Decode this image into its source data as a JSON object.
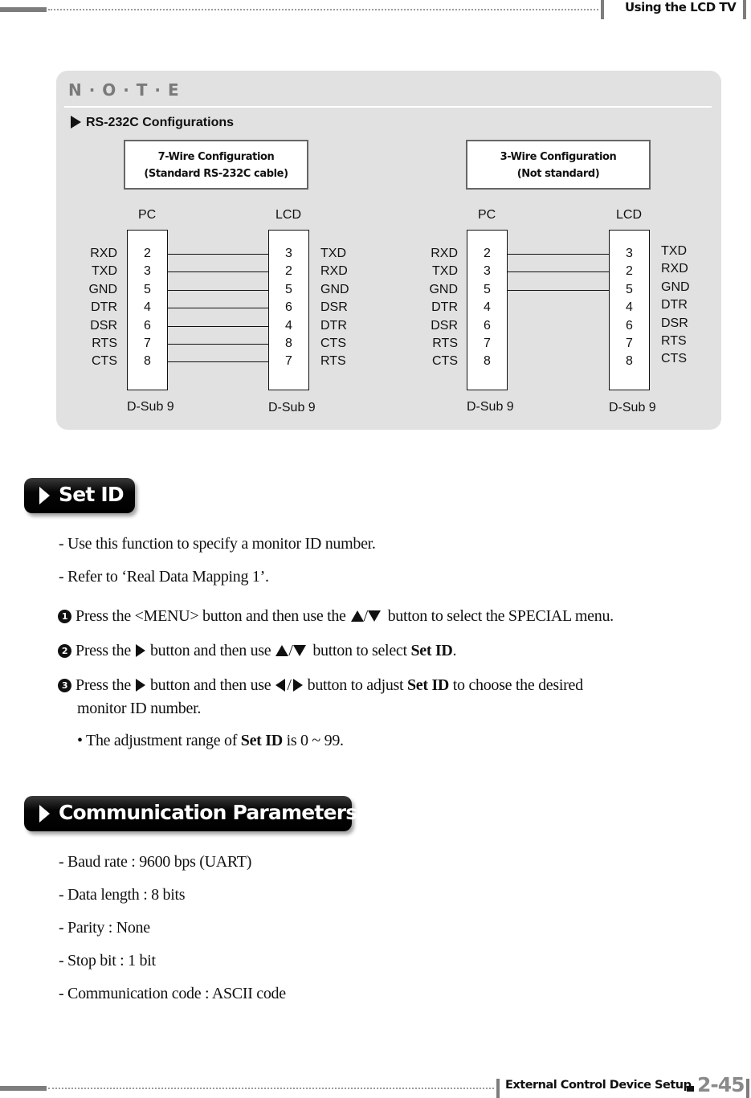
{
  "header": {
    "title": "Using the LCD TV"
  },
  "note": {
    "title": "N · O · T · E",
    "subtitle": "RS-232C Configurations",
    "configs": [
      {
        "title_line1": "7-Wire Configuration",
        "title_line2": "(Standard RS-232C cable)",
        "pc_label": "PC",
        "lcd_label": "LCD",
        "pc_signals": [
          "RXD",
          "TXD",
          "GND",
          "DTR",
          "DSR",
          "RTS",
          "CTS"
        ],
        "pc_pins": [
          "2",
          "3",
          "5",
          "4",
          "6",
          "7",
          "8"
        ],
        "lcd_pins": [
          "3",
          "2",
          "5",
          "6",
          "4",
          "8",
          "7"
        ],
        "lcd_signals": [
          "TXD",
          "RXD",
          "GND",
          "DSR",
          "DTR",
          "CTS",
          "RTS"
        ],
        "wired_rows": [
          0,
          1,
          2,
          3,
          4,
          5,
          6
        ],
        "pc_connector": "D-Sub 9",
        "lcd_connector": "D-Sub 9"
      },
      {
        "title_line1": "3-Wire Configuration",
        "title_line2": "(Not standard)",
        "pc_label": "PC",
        "lcd_label": "LCD",
        "pc_signals": [
          "RXD",
          "TXD",
          "GND",
          "DTR",
          "DSR",
          "RTS",
          "CTS"
        ],
        "pc_pins": [
          "2",
          "3",
          "5",
          "4",
          "6",
          "7",
          "8"
        ],
        "lcd_pins": [
          "3",
          "2",
          "5",
          "4",
          "6",
          "7",
          "8"
        ],
        "lcd_signals": [
          "TXD",
          "RXD",
          "GND",
          "DTR",
          "DSR",
          "RTS",
          "CTS"
        ],
        "wired_rows": [
          0,
          1,
          2
        ],
        "pc_connector": "D-Sub 9",
        "lcd_connector": "D-Sub 9"
      }
    ]
  },
  "set_id": {
    "heading": "Set ID",
    "intro": [
      "- Use this function to specify a monitor ID number.",
      "- Refer to ‘Real Data Mapping 1’."
    ],
    "steps": {
      "s1_num": "1",
      "s1_a": "Press the <MENU> button and then use the",
      "s1_b": "button to select the SPECIAL menu.",
      "s2_num": "2",
      "s2_a": "Press the",
      "s2_b": "button and then use",
      "s2_c": "button to select",
      "s2_bold": "Set ID",
      "s2_end": ".",
      "s3_num": "3",
      "s3_a": "Press the",
      "s3_b": "button and then use",
      "s3_c": "button to adjust",
      "s3_bold": "Set ID",
      "s3_d": "to choose the desired",
      "s3_line2": "monitor ID number.",
      "bullet_a": "• The adjustment range of",
      "bullet_bold": "Set ID",
      "bullet_b": "is 0 ~ 99."
    },
    "slash": "/"
  },
  "comm": {
    "heading": "Communication Parameters",
    "items": [
      "- Baud rate : 9600 bps (UART)",
      "- Data length : 8 bits",
      "- Parity : None",
      "- Stop bit : 1 bit",
      "- Communication code : ASCII code"
    ]
  },
  "footer": {
    "section": "External Control Device Setup",
    "page": "2-45"
  }
}
